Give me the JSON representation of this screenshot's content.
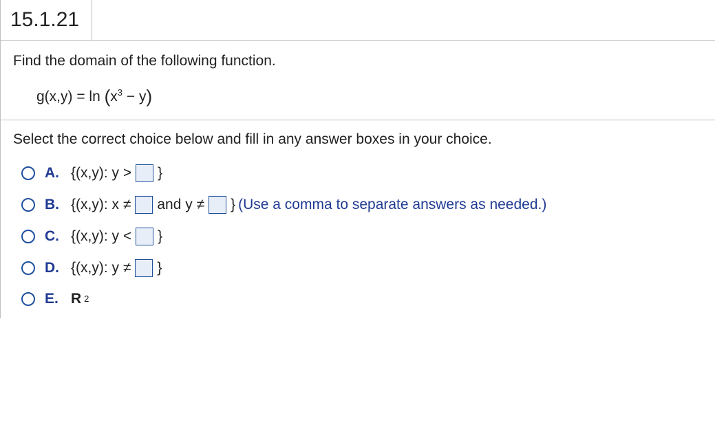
{
  "question_number": "15.1.21",
  "prompt": "Find the domain of the following function.",
  "equation": {
    "lhs": "g(x,y) = ln",
    "inside_pre": "x",
    "inside_exp": "3",
    "inside_post": " − y"
  },
  "instruction": "Select the correct choice below and fill in any answer boxes in your choice.",
  "choices": {
    "A": {
      "label": "A.",
      "pre": "{(x,y): y >",
      "post": "}"
    },
    "B": {
      "label": "B.",
      "pre": "{(x,y): x ≠",
      "mid": " and y ≠",
      "post": "}",
      "hint": " (Use a comma to separate answers as needed.)"
    },
    "C": {
      "label": "C.",
      "pre": "{(x,y): y <",
      "post": "}"
    },
    "D": {
      "label": "D.",
      "pre": "{(x,y): y ≠",
      "post": "}"
    },
    "E": {
      "label": "E.",
      "base": "R",
      "exp": "2"
    }
  }
}
